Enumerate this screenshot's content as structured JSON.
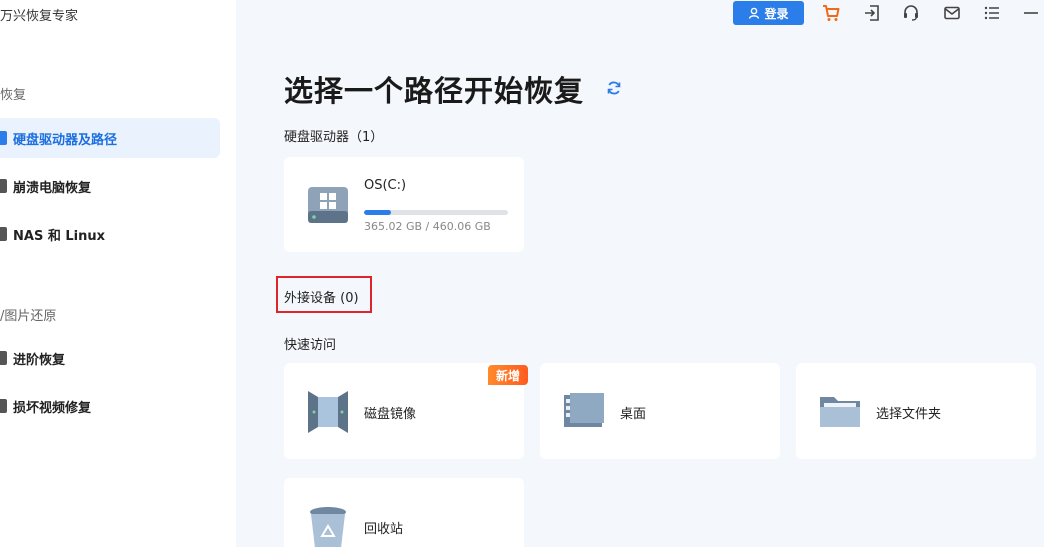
{
  "app": {
    "title": "万兴恢复专家"
  },
  "sidebar": {
    "sections": [
      {
        "label": "恢复"
      },
      {
        "label": "/图片还原"
      }
    ],
    "items": [
      {
        "label": "硬盘驱动器及路径",
        "active": true
      },
      {
        "label": "崩溃电脑恢复"
      },
      {
        "label": "NAS 和 Linux"
      },
      {
        "label": "进阶恢复"
      },
      {
        "label": "损坏视频修复"
      }
    ]
  },
  "topbar": {
    "login_label": "登录",
    "icons": [
      "cart-icon",
      "sign-in-icon",
      "headset-icon",
      "mail-icon",
      "menu-icon",
      "minimize-icon"
    ]
  },
  "main": {
    "title": "选择一个路径开始恢复",
    "hard_drives_label": "硬盘驱动器（1）",
    "external_label": "外接设备 (0)",
    "quick_access_label": "快速访问",
    "drives": [
      {
        "name": "OS(C:)",
        "size_text": "365.02 GB / 460.06 GB",
        "used_fraction": 0.19
      }
    ],
    "quick_access": [
      {
        "label": "磁盘镜像",
        "badge": "新增"
      },
      {
        "label": "桌面"
      },
      {
        "label": "选择文件夹"
      },
      {
        "label": "回收站"
      }
    ]
  },
  "colors": {
    "accent": "#2b7de9",
    "highlight_box": "#e0242b",
    "badge": "#ff6a24",
    "cart": "#f06a1a"
  }
}
